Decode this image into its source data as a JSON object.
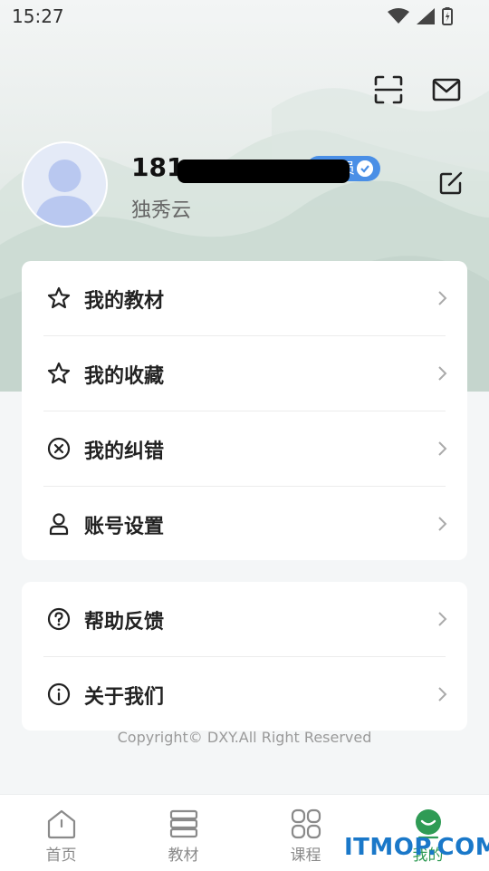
{
  "status_bar": {
    "time": "15:27"
  },
  "profile": {
    "user_id": "181",
    "badge_label": "会员",
    "organization": "独秀云"
  },
  "menu_group1": {
    "items": [
      {
        "label": "我的教材",
        "icon": "star-icon"
      },
      {
        "label": "我的收藏",
        "icon": "star-icon"
      },
      {
        "label": "我的纠错",
        "icon": "error-circle-icon"
      },
      {
        "label": "账号设置",
        "icon": "person-icon"
      }
    ]
  },
  "menu_group2": {
    "items": [
      {
        "label": "帮助反馈",
        "icon": "help-icon"
      },
      {
        "label": "关于我们",
        "icon": "info-icon"
      }
    ]
  },
  "copyright": "Copyright© DXY.All Right Reserved",
  "tabbar": {
    "tabs": [
      {
        "label": "首页",
        "icon": "home-icon"
      },
      {
        "label": "教材",
        "icon": "books-icon"
      },
      {
        "label": "课程",
        "icon": "grid-icon"
      },
      {
        "label": "我的",
        "icon": "smile-icon",
        "active": true
      }
    ]
  },
  "watermark": "ITMOP.COM",
  "colors": {
    "accent": "#2f9b55",
    "badge": "#4a8fe6"
  }
}
